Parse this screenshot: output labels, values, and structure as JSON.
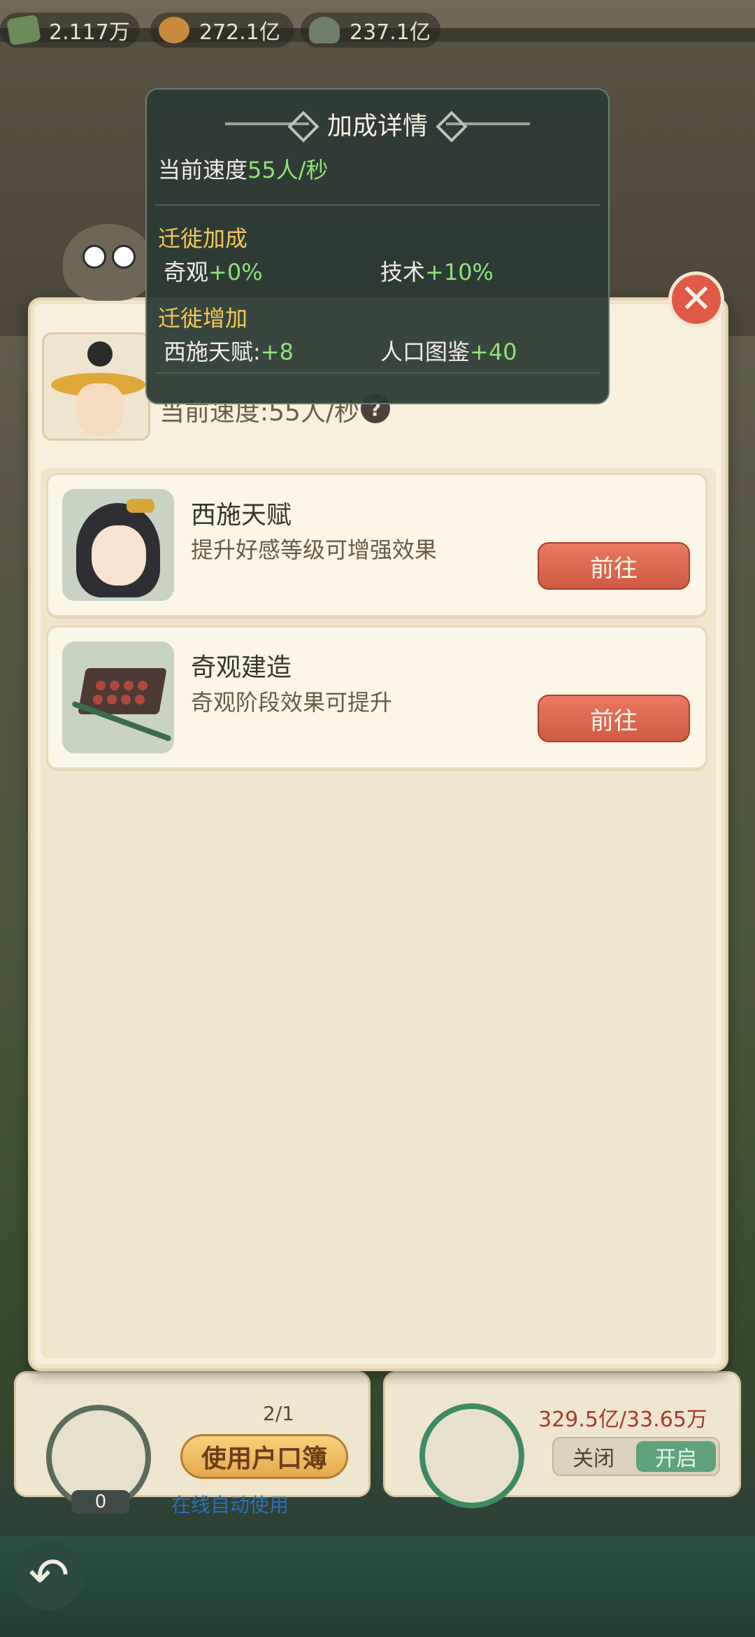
{
  "resources": [
    {
      "icon": "jade-icon",
      "value": "2.117万"
    },
    {
      "icon": "money-bag-icon",
      "value": "272.1亿"
    },
    {
      "icon": "stone-icon",
      "value": "237.1亿"
    }
  ],
  "tooltip": {
    "title": "加成详情",
    "speed_label": "当前速度",
    "speed_value": "55人/秒",
    "migration_bonus": {
      "heading": "迁徙加成",
      "items": [
        {
          "label": "奇观",
          "value": "+0%"
        },
        {
          "label": "技术",
          "value": "+10%"
        }
      ]
    },
    "migration_increase": {
      "heading": "迁徙增加",
      "items": [
        {
          "label": "西施天赋:",
          "value": "+8"
        },
        {
          "label": "人口图鉴",
          "value": "+40"
        }
      ]
    }
  },
  "panel": {
    "speed_ghost": "当前速度:55人/秒",
    "help_symbol": "?",
    "close_symbol": "✕"
  },
  "cards": [
    {
      "title": "西施天赋",
      "desc": "提升好感等级可增强效果",
      "button": "前往"
    },
    {
      "title": "奇观建造",
      "desc": "奇观阶段效果可提升",
      "button": "前往"
    }
  ],
  "bottom": {
    "avatar_count": "0",
    "hukou_count": "2/1",
    "hukou_button": "使用户口簿",
    "auto_use": "在线自动使用",
    "fruit_value": "329.5亿/33.65万",
    "toggle_off": "关闭",
    "toggle_on": "开启"
  },
  "colors": {
    "accent_green": "#8fe27a",
    "heading_gold": "#f2c75a",
    "button_red": "#d05a44"
  }
}
